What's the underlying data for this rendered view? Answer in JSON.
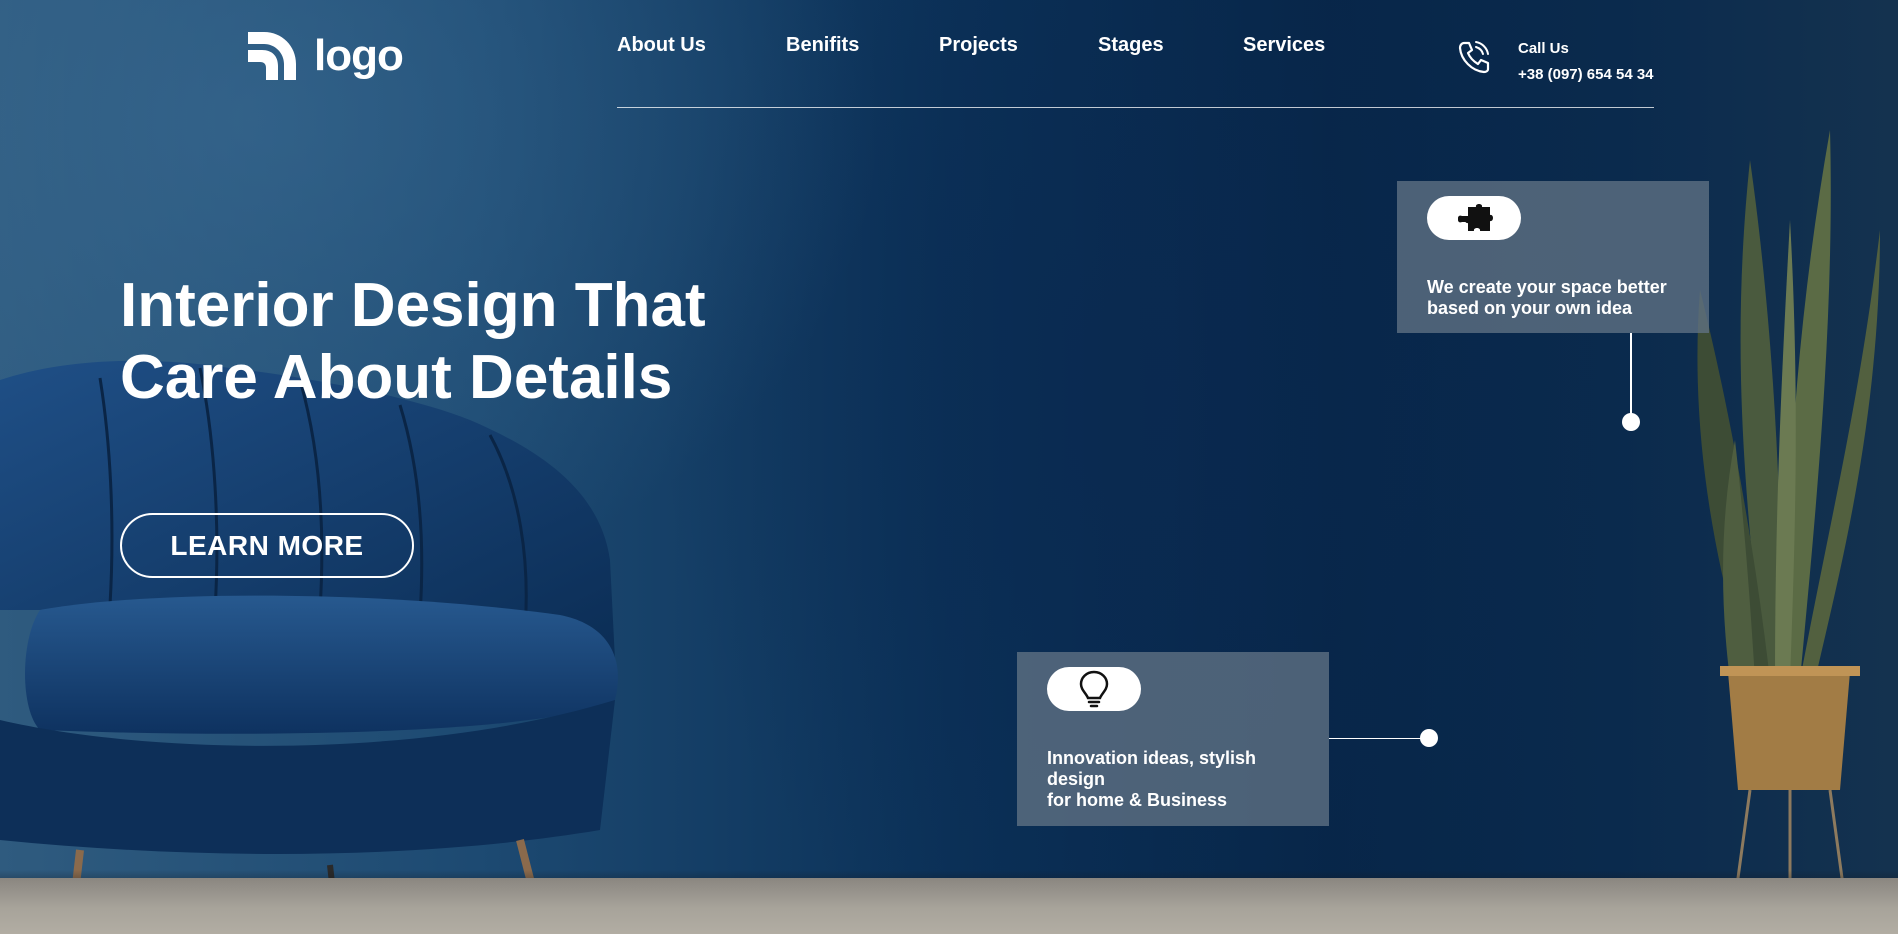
{
  "logo": {
    "text": "logo"
  },
  "nav": {
    "items": [
      {
        "label": "About Us"
      },
      {
        "label": "Benifits"
      },
      {
        "label": "Projects"
      },
      {
        "label": "Stages"
      },
      {
        "label": "Services"
      }
    ]
  },
  "contact": {
    "icon": "phone-icon",
    "label": "Call Us",
    "number": "+38 (097) 654 54 34"
  },
  "hero": {
    "headline_line1": "Interior Design That",
    "headline_line2": "Care About Details",
    "button_label": "LEARN MORE"
  },
  "cards": [
    {
      "icon": "puzzle-icon",
      "text": "We create your space better\nbased on your own idea"
    },
    {
      "icon": "lightbulb-icon",
      "text": "Innovation ideas, stylish\ndesign\nfor home & Business"
    }
  ],
  "colors": {
    "background": "#0f2f52",
    "card": "#607284",
    "text": "#ffffff"
  }
}
